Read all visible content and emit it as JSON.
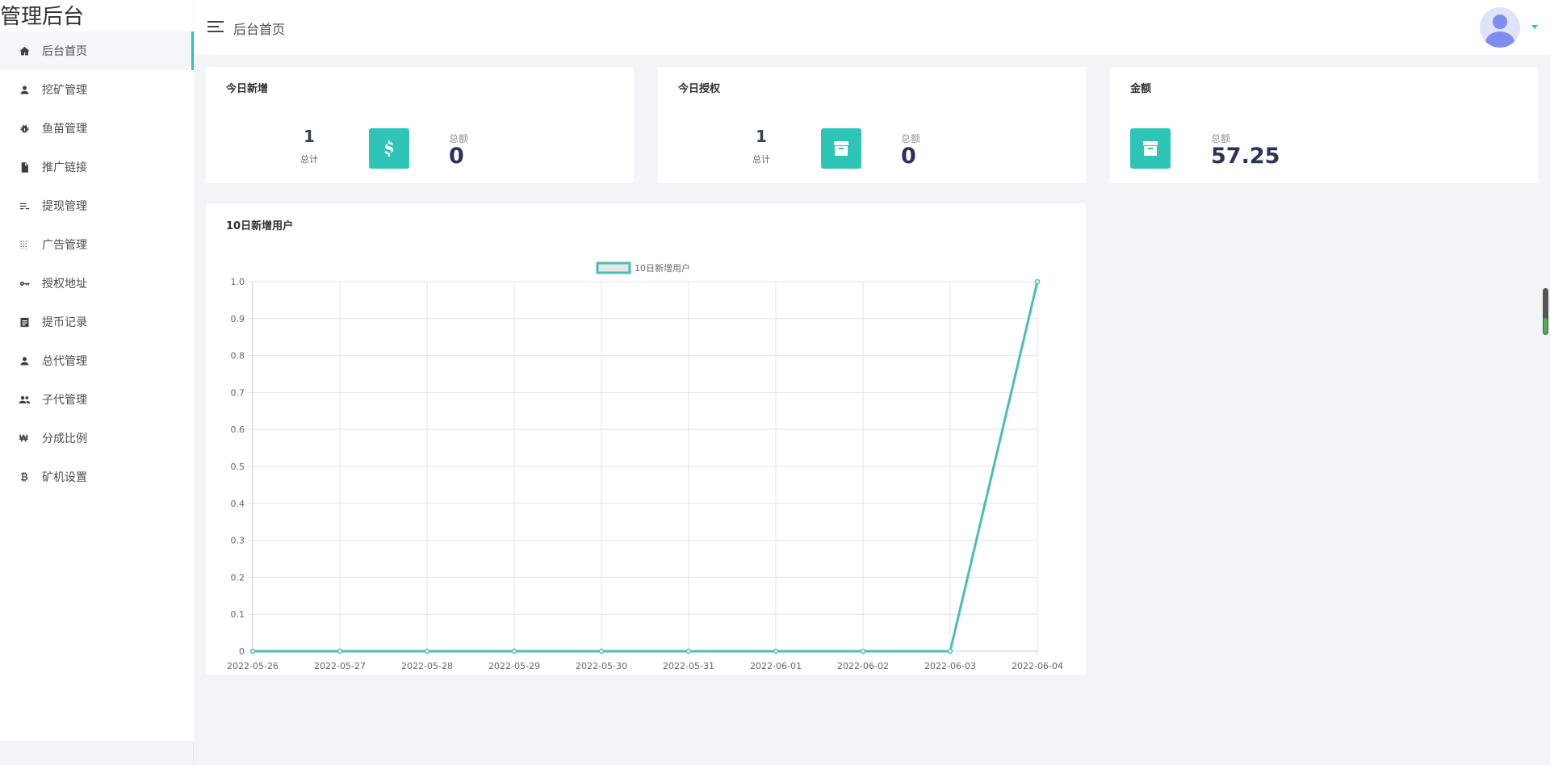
{
  "brand": "管理后台",
  "sidebar": {
    "items": [
      {
        "label": "后台首页",
        "icon": "home-icon"
      },
      {
        "label": "挖矿管理",
        "icon": "user-icon"
      },
      {
        "label": "鱼苗管理",
        "icon": "bug-icon"
      },
      {
        "label": "推广链接",
        "icon": "document-icon"
      },
      {
        "label": "提现管理",
        "icon": "list-icon"
      },
      {
        "label": "广告管理",
        "icon": "grid-icon"
      },
      {
        "label": "授权地址",
        "icon": "key-icon"
      },
      {
        "label": "提币记录",
        "icon": "note-icon"
      },
      {
        "label": "总代管理",
        "icon": "user-icon"
      },
      {
        "label": "子代管理",
        "icon": "users-icon"
      },
      {
        "label": "分成比例",
        "icon": "won-icon"
      },
      {
        "label": "矿机设置",
        "icon": "bitcoin-icon"
      }
    ]
  },
  "header": {
    "title": "后台首页"
  },
  "cards": {
    "today_new": {
      "title": "今日新增",
      "count": "1",
      "count_label": "总计",
      "amount_label": "总额",
      "amount": "0",
      "icon": "dollar-icon"
    },
    "today_auth": {
      "title": "今日授权",
      "count": "1",
      "count_label": "总计",
      "amount_label": "总额",
      "amount": "0",
      "icon": "archive-icon"
    },
    "amount": {
      "title": "金额",
      "amount_label": "总额",
      "amount": "57.25",
      "icon": "archive-icon"
    }
  },
  "chart_card": {
    "title": "10日新增用户"
  },
  "colors": {
    "accent": "#2ec4b6",
    "line": "#4bbdb7"
  },
  "scroll_indicator": {
    "level": 0.35
  },
  "chart_data": {
    "type": "line",
    "title": "",
    "xlabel": "",
    "ylabel": "",
    "x": [
      "2022-05-26",
      "2022-05-27",
      "2022-05-28",
      "2022-05-29",
      "2022-05-30",
      "2022-05-31",
      "2022-06-01",
      "2022-06-02",
      "2022-06-03",
      "2022-06-04"
    ],
    "series": [
      {
        "name": "10日新增用户",
        "values": [
          0,
          0,
          0,
          0,
          0,
          0,
          0,
          0,
          0,
          1
        ]
      }
    ],
    "ylim": [
      0,
      1.0
    ],
    "yticks": [
      "0",
      "0.1",
      "0.2",
      "0.3",
      "0.4",
      "0.5",
      "0.6",
      "0.7",
      "0.8",
      "0.9",
      "1.0"
    ],
    "grid": true,
    "legend": "top-center"
  }
}
